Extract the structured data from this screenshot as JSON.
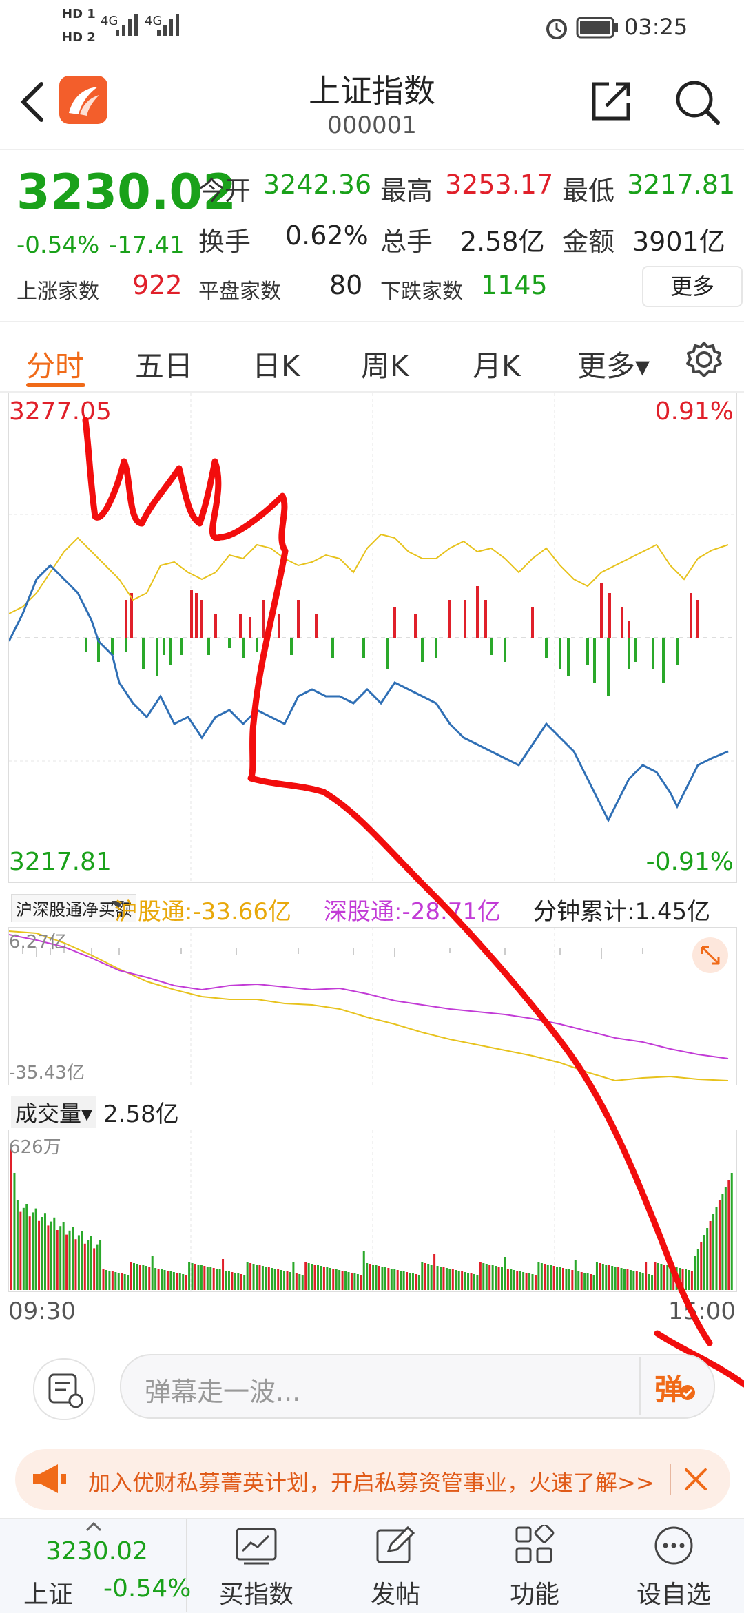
{
  "status_bar": {
    "sim1": "HD 1",
    "sim2": "HD 2",
    "net1": "4G",
    "net2": "4G",
    "time": "03:25"
  },
  "header": {
    "title": "上证指数",
    "code": "000001",
    "back_icon": "chevron-left-icon",
    "share_icon": "share-icon",
    "search_icon": "search-icon"
  },
  "quote": {
    "price": "3230.02",
    "change_pct": "-0.54%",
    "change": "-17.41",
    "open_label": "今开",
    "open": "3242.36",
    "high_label": "最高",
    "high": "3253.17",
    "low_label": "最低",
    "low": "3217.81",
    "turnover_label": "换手",
    "turnover": "0.62%",
    "volume_label": "总手",
    "volume": "2.58亿",
    "amount_label": "金额",
    "amount": "3901亿",
    "up_label": "上涨家数",
    "up": "922",
    "flat_label": "平盘家数",
    "flat": "80",
    "down_label": "下跌家数",
    "down": "1145",
    "more": "更多"
  },
  "tabs": [
    {
      "label": "分时",
      "active": true
    },
    {
      "label": "五日"
    },
    {
      "label": "日K"
    },
    {
      "label": "周K"
    },
    {
      "label": "月K"
    },
    {
      "label": "更多▾"
    }
  ],
  "chart": {
    "top_left": "3277.05",
    "top_right": "0.91%",
    "bottom_left": "3217.81",
    "bottom_right": "-0.91%"
  },
  "flow": {
    "selector": "沪深股通净买额",
    "hgt": "沪股通:-33.66亿",
    "sgt": "深股通:-28.71亿",
    "cumulative": "分钟累计:1.45亿",
    "top_label": "6.27亿",
    "bottom_label": "-35.43亿"
  },
  "volume": {
    "selector": "成交量▾",
    "value": "2.58亿",
    "top_label": "626万",
    "time_start": "09:30",
    "time_end": "15:00"
  },
  "comment": {
    "placeholder": "弹幕走一波...",
    "send": "弹"
  },
  "ad": {
    "text": "加入优财私募菁英计划，开启私募资管事业，火速了解>>"
  },
  "nav": {
    "index_price": "3230.02",
    "index_name": "上证",
    "index_pct": "-0.54%",
    "items": [
      "买指数",
      "发帖",
      "功能",
      "设自选"
    ]
  },
  "colors": {
    "up": "#e0202a",
    "down": "#1aa11a",
    "accent": "#f06a18",
    "price_line": "#2f6fb5",
    "avg_line": "#e7c21c",
    "sgt_line": "#c23bd6"
  }
}
